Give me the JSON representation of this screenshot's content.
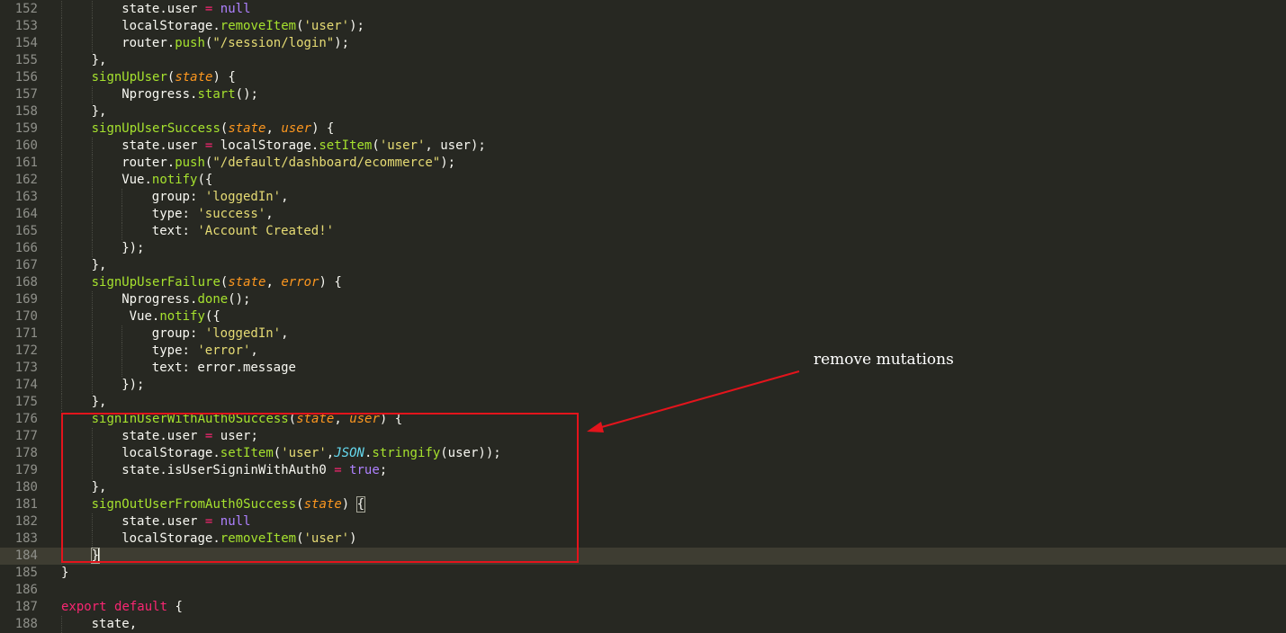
{
  "editor": {
    "current_line": "184",
    "lines": [
      {
        "n": "152",
        "indent": 2,
        "tokens": [
          {
            "t": "state.user ",
            "c": "plain"
          },
          {
            "t": "=",
            "c": "kw"
          },
          {
            "t": " ",
            "c": "plain"
          },
          {
            "t": "null",
            "c": "num"
          }
        ]
      },
      {
        "n": "153",
        "indent": 2,
        "tokens": [
          {
            "t": "localStorage.",
            "c": "plain"
          },
          {
            "t": "removeItem",
            "c": "fn"
          },
          {
            "t": "(",
            "c": "plain"
          },
          {
            "t": "'user'",
            "c": "str"
          },
          {
            "t": ");",
            "c": "plain"
          }
        ]
      },
      {
        "n": "154",
        "indent": 2,
        "tokens": [
          {
            "t": "router.",
            "c": "plain"
          },
          {
            "t": "push",
            "c": "fn"
          },
          {
            "t": "(",
            "c": "plain"
          },
          {
            "t": "\"/session/login\"",
            "c": "str"
          },
          {
            "t": ");",
            "c": "plain"
          }
        ]
      },
      {
        "n": "155",
        "indent": 1,
        "tokens": [
          {
            "t": "},",
            "c": "plain"
          }
        ]
      },
      {
        "n": "156",
        "indent": 1,
        "tokens": [
          {
            "t": "signUpUser",
            "c": "fn"
          },
          {
            "t": "(",
            "c": "plain"
          },
          {
            "t": "state",
            "c": "param"
          },
          {
            "t": ") {",
            "c": "plain"
          }
        ]
      },
      {
        "n": "157",
        "indent": 2,
        "tokens": [
          {
            "t": "Nprogress.",
            "c": "plain"
          },
          {
            "t": "start",
            "c": "fn"
          },
          {
            "t": "();",
            "c": "plain"
          }
        ]
      },
      {
        "n": "158",
        "indent": 1,
        "tokens": [
          {
            "t": "},",
            "c": "plain"
          }
        ]
      },
      {
        "n": "159",
        "indent": 1,
        "tokens": [
          {
            "t": "signUpUserSuccess",
            "c": "fn"
          },
          {
            "t": "(",
            "c": "plain"
          },
          {
            "t": "state",
            "c": "param"
          },
          {
            "t": ", ",
            "c": "plain"
          },
          {
            "t": "user",
            "c": "param"
          },
          {
            "t": ") {",
            "c": "plain"
          }
        ]
      },
      {
        "n": "160",
        "indent": 2,
        "tokens": [
          {
            "t": "state.user ",
            "c": "plain"
          },
          {
            "t": "=",
            "c": "kw"
          },
          {
            "t": " localStorage.",
            "c": "plain"
          },
          {
            "t": "setItem",
            "c": "fn"
          },
          {
            "t": "(",
            "c": "plain"
          },
          {
            "t": "'user'",
            "c": "str"
          },
          {
            "t": ", user);",
            "c": "plain"
          }
        ]
      },
      {
        "n": "161",
        "indent": 2,
        "tokens": [
          {
            "t": "router.",
            "c": "plain"
          },
          {
            "t": "push",
            "c": "fn"
          },
          {
            "t": "(",
            "c": "plain"
          },
          {
            "t": "\"/default/dashboard/ecommerce\"",
            "c": "str"
          },
          {
            "t": ");",
            "c": "plain"
          }
        ]
      },
      {
        "n": "162",
        "indent": 2,
        "tokens": [
          {
            "t": "Vue.",
            "c": "plain"
          },
          {
            "t": "notify",
            "c": "fn"
          },
          {
            "t": "({",
            "c": "plain"
          }
        ]
      },
      {
        "n": "163",
        "indent": 3,
        "tokens": [
          {
            "t": "group: ",
            "c": "plain"
          },
          {
            "t": "'loggedIn'",
            "c": "str"
          },
          {
            "t": ",",
            "c": "plain"
          }
        ]
      },
      {
        "n": "164",
        "indent": 3,
        "tokens": [
          {
            "t": "type: ",
            "c": "plain"
          },
          {
            "t": "'success'",
            "c": "str"
          },
          {
            "t": ",",
            "c": "plain"
          }
        ]
      },
      {
        "n": "165",
        "indent": 3,
        "tokens": [
          {
            "t": "text: ",
            "c": "plain"
          },
          {
            "t": "'Account Created!'",
            "c": "str"
          }
        ]
      },
      {
        "n": "166",
        "indent": 2,
        "tokens": [
          {
            "t": "});",
            "c": "plain"
          }
        ]
      },
      {
        "n": "167",
        "indent": 1,
        "tokens": [
          {
            "t": "},",
            "c": "plain"
          }
        ]
      },
      {
        "n": "168",
        "indent": 1,
        "tokens": [
          {
            "t": "signUpUserFailure",
            "c": "fn"
          },
          {
            "t": "(",
            "c": "plain"
          },
          {
            "t": "state",
            "c": "param"
          },
          {
            "t": ", ",
            "c": "plain"
          },
          {
            "t": "error",
            "c": "param"
          },
          {
            "t": ") {",
            "c": "plain"
          }
        ]
      },
      {
        "n": "169",
        "indent": 2,
        "tokens": [
          {
            "t": "Nprogress.",
            "c": "plain"
          },
          {
            "t": "done",
            "c": "fn"
          },
          {
            "t": "();",
            "c": "plain"
          }
        ]
      },
      {
        "n": "170",
        "indent": 2,
        "tokens": [
          {
            "t": " Vue.",
            "c": "plain"
          },
          {
            "t": "notify",
            "c": "fn"
          },
          {
            "t": "({",
            "c": "plain"
          }
        ]
      },
      {
        "n": "171",
        "indent": 3,
        "tokens": [
          {
            "t": "group: ",
            "c": "plain"
          },
          {
            "t": "'loggedIn'",
            "c": "str"
          },
          {
            "t": ",",
            "c": "plain"
          }
        ]
      },
      {
        "n": "172",
        "indent": 3,
        "tokens": [
          {
            "t": "type: ",
            "c": "plain"
          },
          {
            "t": "'error'",
            "c": "str"
          },
          {
            "t": ",",
            "c": "plain"
          }
        ]
      },
      {
        "n": "173",
        "indent": 3,
        "tokens": [
          {
            "t": "text: error.message",
            "c": "plain"
          }
        ]
      },
      {
        "n": "174",
        "indent": 2,
        "tokens": [
          {
            "t": "});",
            "c": "plain"
          }
        ]
      },
      {
        "n": "175",
        "indent": 1,
        "tokens": [
          {
            "t": "},",
            "c": "plain"
          }
        ]
      },
      {
        "n": "176",
        "indent": 1,
        "tokens": [
          {
            "t": "signInUserWithAuth0Success",
            "c": "fn"
          },
          {
            "t": "(",
            "c": "plain"
          },
          {
            "t": "state",
            "c": "param"
          },
          {
            "t": ", ",
            "c": "plain"
          },
          {
            "t": "user",
            "c": "param"
          },
          {
            "t": ") {",
            "c": "plain"
          }
        ]
      },
      {
        "n": "177",
        "indent": 2,
        "tokens": [
          {
            "t": "state.user ",
            "c": "plain"
          },
          {
            "t": "=",
            "c": "kw"
          },
          {
            "t": " user;",
            "c": "plain"
          }
        ]
      },
      {
        "n": "178",
        "indent": 2,
        "tokens": [
          {
            "t": "localStorage.",
            "c": "plain"
          },
          {
            "t": "setItem",
            "c": "fn"
          },
          {
            "t": "(",
            "c": "plain"
          },
          {
            "t": "'user'",
            "c": "str"
          },
          {
            "t": ",",
            "c": "plain"
          },
          {
            "t": "JSON",
            "c": "type"
          },
          {
            "t": ".",
            "c": "plain"
          },
          {
            "t": "stringify",
            "c": "fn"
          },
          {
            "t": "(user));",
            "c": "plain"
          }
        ]
      },
      {
        "n": "179",
        "indent": 2,
        "tokens": [
          {
            "t": "state.isUserSigninWithAuth0 ",
            "c": "plain"
          },
          {
            "t": "=",
            "c": "kw"
          },
          {
            "t": " ",
            "c": "plain"
          },
          {
            "t": "true",
            "c": "num"
          },
          {
            "t": ";",
            "c": "plain"
          }
        ]
      },
      {
        "n": "180",
        "indent": 1,
        "tokens": [
          {
            "t": "},",
            "c": "plain"
          }
        ]
      },
      {
        "n": "181",
        "indent": 1,
        "tokens": [
          {
            "t": "signOutUserFromAuth0Success",
            "c": "fn"
          },
          {
            "t": "(",
            "c": "plain"
          },
          {
            "t": "state",
            "c": "param"
          },
          {
            "t": ") ",
            "c": "plain"
          },
          {
            "t": "{",
            "c": "match"
          }
        ]
      },
      {
        "n": "182",
        "indent": 2,
        "tokens": [
          {
            "t": "state.user ",
            "c": "plain"
          },
          {
            "t": "=",
            "c": "kw"
          },
          {
            "t": " ",
            "c": "plain"
          },
          {
            "t": "null",
            "c": "num"
          }
        ]
      },
      {
        "n": "183",
        "indent": 2,
        "tokens": [
          {
            "t": "localStorage.",
            "c": "plain"
          },
          {
            "t": "removeItem",
            "c": "fn"
          },
          {
            "t": "(",
            "c": "plain"
          },
          {
            "t": "'user'",
            "c": "str"
          },
          {
            "t": ")",
            "c": "plain"
          }
        ]
      },
      {
        "n": "184",
        "indent": 1,
        "tokens": [
          {
            "t": "}",
            "c": "match"
          },
          {
            "t": "",
            "c": "cursor"
          }
        ]
      },
      {
        "n": "185",
        "indent": 0,
        "tokens": [
          {
            "t": "}",
            "c": "plain"
          }
        ]
      },
      {
        "n": "186",
        "indent": 0,
        "tokens": []
      },
      {
        "n": "187",
        "indent": 0,
        "tokens": [
          {
            "t": "export",
            "c": "kw"
          },
          {
            "t": " ",
            "c": "plain"
          },
          {
            "t": "default",
            "c": "kw"
          },
          {
            "t": " {",
            "c": "plain"
          }
        ]
      },
      {
        "n": "188",
        "indent": 1,
        "tokens": [
          {
            "t": "state,",
            "c": "plain"
          }
        ]
      }
    ]
  },
  "annotation": {
    "text": "remove mutations",
    "color": "#e3141c"
  },
  "theme": {
    "background": "#272822",
    "current_line_bg": "#3e3d32",
    "gutter_fg": "#8f908a"
  }
}
